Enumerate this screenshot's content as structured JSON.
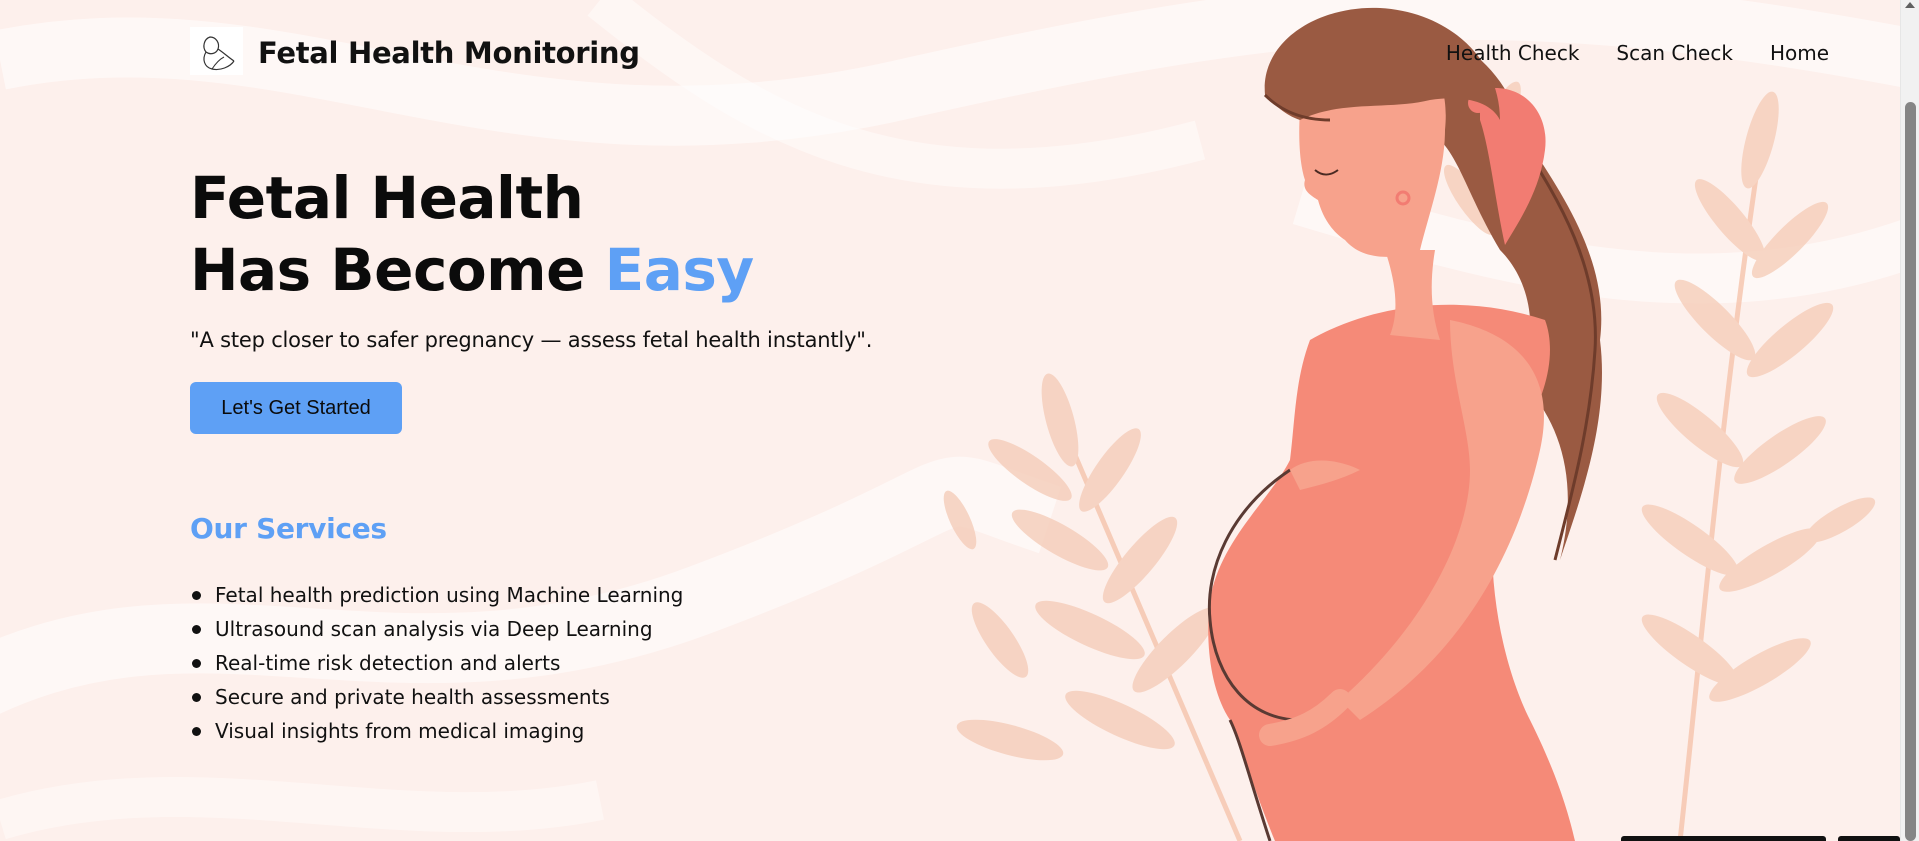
{
  "nav": {
    "brand": "Fetal Health Monitoring",
    "links": [
      "Health Check",
      "Scan Check",
      "Home"
    ]
  },
  "hero": {
    "title_line1": "Fetal Health",
    "title_line2_prefix": "Has Become ",
    "title_line2_accent": "Easy",
    "tagline": "\"A step closer to safer pregnancy — assess fetal health instantly\".",
    "cta_label": "Let's Get Started"
  },
  "services": {
    "title": "Our Services",
    "items": [
      "Fetal health prediction using Machine Learning",
      "Ultrasound scan analysis via Deep Learning",
      "Real-time risk detection and alerts",
      "Secure and private health assessments",
      "Visual insights from medical imaging"
    ]
  },
  "colors": {
    "accent": "#5ea0f5",
    "background": "#fdf0ec",
    "dress": "#f58a78",
    "hair": "#9a5a42",
    "leaf": "#f5c9b4"
  },
  "icons": {
    "logo": "baby-logo-icon"
  }
}
